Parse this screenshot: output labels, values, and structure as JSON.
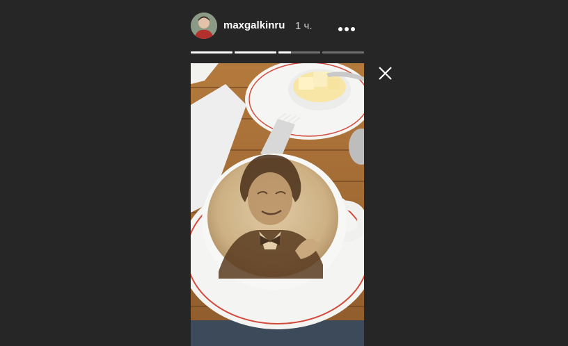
{
  "story": {
    "username": "maxgalkinru",
    "time_ago": "1 ч.",
    "progress": [
      1,
      1,
      0.3,
      0
    ],
    "avatar_icon": "user-avatar",
    "more_icon": "more-horizontal-icon",
    "close_icon": "close-icon",
    "media": "coffee-latte-portrait-photo"
  }
}
